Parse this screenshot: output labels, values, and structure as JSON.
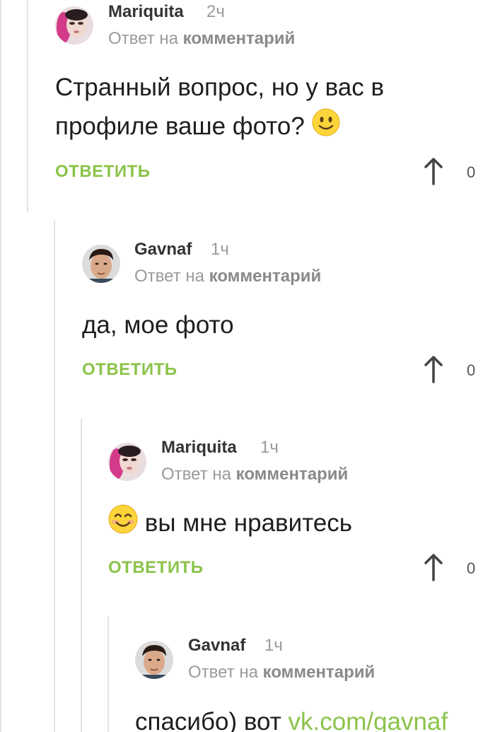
{
  "comments": [
    {
      "author": "Mariquita",
      "time": "2ч",
      "reply_prefix": "Ответ на",
      "reply_target": "комментарий",
      "text": "Странный вопрос, но у вас в",
      "text_line2": "профиле ваше фото?",
      "reply_label": "ОТВЕТИТЬ",
      "votes": "0"
    },
    {
      "author": "Gavnaf",
      "time": "1ч",
      "reply_prefix": "Ответ на",
      "reply_target": "комментарий",
      "text": "да, мое фото",
      "reply_label": "ОТВЕТИТЬ",
      "votes": "0"
    },
    {
      "author": "Mariquita",
      "time": "1ч",
      "reply_prefix": "Ответ на",
      "reply_target": "комментарий",
      "text": "вы мне нравитесь",
      "reply_label": "ОТВЕТИТЬ",
      "votes": "0"
    },
    {
      "author": "Gavnaf",
      "time": "1ч",
      "reply_prefix": "Ответ на",
      "reply_target": "комментарий",
      "text": "спасибо) вот",
      "link": "vk.com/gavnaf"
    }
  ],
  "colors": {
    "accent": "#8bc34a",
    "muted": "#9a9a9a",
    "thread_line": "#e3e3e3"
  },
  "icons": {
    "slight_smile": "slightly-smiling-face-emoji",
    "blush": "smiling-face-with-smiling-eyes-emoji",
    "upvote": "arrow-up-icon"
  }
}
